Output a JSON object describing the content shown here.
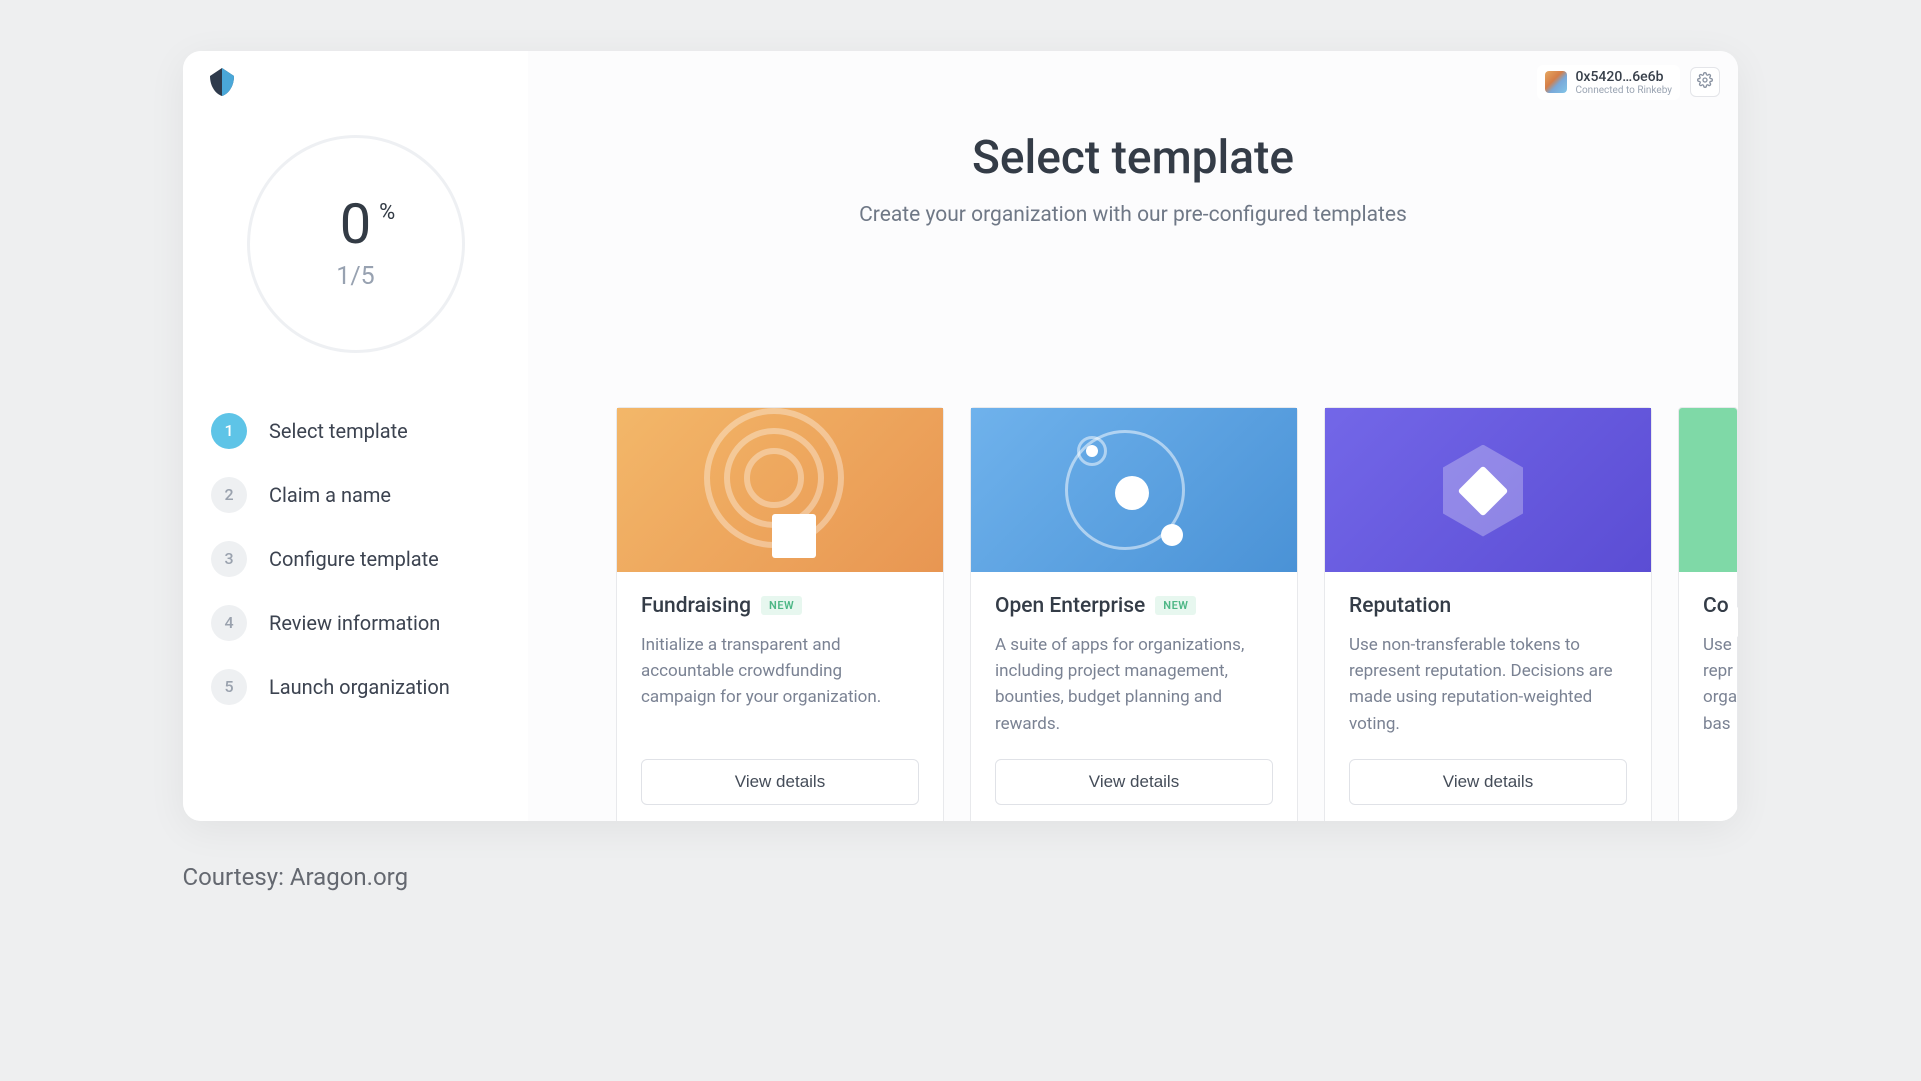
{
  "header": {
    "wallet_address": "0x5420…6e6b",
    "wallet_status": "Connected to Rinkeby"
  },
  "sidebar": {
    "progress_percent": "0",
    "progress_step_label": "1/5",
    "steps": [
      {
        "num": "1",
        "label": "Select template",
        "active": true
      },
      {
        "num": "2",
        "label": "Claim a name",
        "active": false
      },
      {
        "num": "3",
        "label": "Configure template",
        "active": false
      },
      {
        "num": "4",
        "label": "Review information",
        "active": false
      },
      {
        "num": "5",
        "label": "Launch organization",
        "active": false
      }
    ]
  },
  "main": {
    "title": "Select template",
    "subtitle": "Create your organization with our pre-configured templates",
    "view_details_label": "View details",
    "new_badge_label": "NEW",
    "templates": [
      {
        "id": "fundraising",
        "title": "Fundraising",
        "is_new": true,
        "desc": "Initialize a transparent and accountable crowdfunding campaign for your organization."
      },
      {
        "id": "open-enterprise",
        "title": "Open Enterprise",
        "is_new": true,
        "desc": "A suite of apps for organizations, including project management, bounties, budget planning and rewards."
      },
      {
        "id": "reputation",
        "title": "Reputation",
        "is_new": false,
        "desc": "Use non-transferable tokens to represent reputation. Decisions are made using reputation-weighted voting."
      },
      {
        "id": "company",
        "title": "Co",
        "is_new": false,
        "desc": "Use repr orga bas"
      }
    ]
  },
  "caption": "Courtesy: Aragon.org"
}
